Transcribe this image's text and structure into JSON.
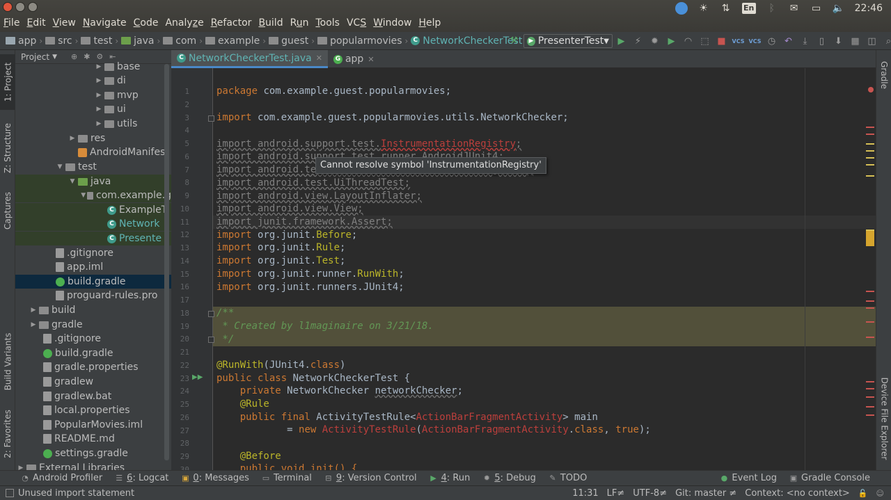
{
  "menu": [
    {
      "pre": "",
      "mn": "F",
      "post": "ile"
    },
    {
      "pre": "",
      "mn": "E",
      "post": "dit"
    },
    {
      "pre": "",
      "mn": "V",
      "post": "iew"
    },
    {
      "pre": "",
      "mn": "N",
      "post": "avigate"
    },
    {
      "pre": "",
      "mn": "C",
      "post": "ode"
    },
    {
      "pre": "Analy",
      "mn": "z",
      "post": "e"
    },
    {
      "pre": "",
      "mn": "R",
      "post": "efactor"
    },
    {
      "pre": "",
      "mn": "B",
      "post": "uild"
    },
    {
      "pre": "R",
      "mn": "u",
      "post": "n"
    },
    {
      "pre": "",
      "mn": "T",
      "post": "ools"
    },
    {
      "pre": "VC",
      "mn": "S",
      "post": ""
    },
    {
      "pre": "",
      "mn": "W",
      "post": "indow"
    },
    {
      "pre": "",
      "mn": "H",
      "post": "elp"
    }
  ],
  "tray": {
    "lang": "En",
    "time": "22:46"
  },
  "breadcrumb": [
    "app",
    "src",
    "test",
    "java",
    "com",
    "example",
    "guest",
    "popularmovies",
    "NetworkCheckerTest"
  ],
  "run_config": "PresenterTest",
  "left_tabs": {
    "project": "1: Project",
    "structure": "Z: Structure",
    "captures": "Captures",
    "build_variants": "Build Variants",
    "favorites": "2: Favorites"
  },
  "right_tabs": {
    "gradle": "Gradle",
    "device": "Device File Explorer"
  },
  "project_panel": {
    "title": "Project"
  },
  "tree": {
    "base": "base",
    "di": "di",
    "mvp": "mvp",
    "ui": "ui",
    "utils": "utils",
    "res": "res",
    "manifest": "AndroidManifest",
    "test": "test",
    "java": "java",
    "pkg": "com.example.g",
    "example_test": "ExampleT",
    "network_test": "Network",
    "presenter_test": "Presente",
    "gitignore_app": ".gitignore",
    "app_iml": "app.iml",
    "build_gradle_app": "build.gradle",
    "proguard": "proguard-rules.pro",
    "build": "build",
    "gradle": "gradle",
    "gitignore": ".gitignore",
    "build_gradle": "build.gradle",
    "gradle_props": "gradle.properties",
    "gradlew": "gradlew",
    "gradlew_bat": "gradlew.bat",
    "local_props": "local.properties",
    "iml": "PopularMovies.iml",
    "readme": "README.md",
    "settings": "settings.gradle",
    "ext": "External Libraries"
  },
  "tabs": [
    {
      "label": "NetworkCheckerTest.java"
    },
    {
      "label": "app"
    }
  ],
  "code": {
    "l1_kw": "package",
    "l1_rest": " com.example.guest.popularmovies;",
    "l3_kw": "import",
    "l3_rest": " com.example.guest.popularmovies.utils.NetworkChecker;",
    "l5_a": "import android.support.test.",
    "l5_err": "InstrumentationRegistry",
    "l5_end": ";",
    "l6": "import android.support.test.runner.AndroidJUnit4;",
    "l7": "import android.test.suitebuilder.annotation.LargeTest;",
    "l8": "import android.test.UiThreadTest;",
    "l9": "import android.view.LayoutInflater;",
    "l10": "import android.view.View;",
    "l11": "import junit.framework.Assert;",
    "l12_kw": "import",
    "l12_a": " org.junit.",
    "l12_b": "Before",
    "l12_c": ";",
    "l13_kw": "import",
    "l13_a": " org.junit.",
    "l13_b": "Rule",
    "l13_c": ";",
    "l14_kw": "import",
    "l14_a": " org.junit.",
    "l14_b": "Test",
    "l14_c": ";",
    "l15_kw": "import",
    "l15_a": " org.junit.runner.",
    "l15_b": "RunWith",
    "l15_c": ";",
    "l16_kw": "import",
    "l16_a": " org.junit.runners.JUnit4;",
    "l18": "/**",
    "l19": " * Created by l1maginaire on 3/21/18.",
    "l20": " */",
    "l22_ann": "@RunWith",
    "l22_a": "(JUnit4.",
    "l22_kw": "class",
    "l22_b": ")",
    "l23_kw": "public class",
    "l23_a": " NetworkCheckerTest {",
    "l24_kw": "    private",
    "l24_a": " NetworkChecker ",
    "l24_u": "networkChecker",
    "l24_b": ";",
    "l25_ann": "    @Rule",
    "l26_kw": "    public final",
    "l26_a": " ActivityTestRule<",
    "l26_r": "ActionBarFragmentActivity",
    "l26_b": "> main",
    "l27_a": "            = ",
    "l27_kw": "new",
    "l27_r1": " ActivityTestRule",
    "l27_b": "(",
    "l27_r2": "ActionBarFragmentActivity",
    "l27_c": ".",
    "l27_kw2": "class",
    "l27_d": ", ",
    "l27_kw3": "true",
    "l27_e": ");",
    "l29_ann": "    @Before",
    "l30": "    public void init() {"
  },
  "tooltip": "Cannot resolve symbol 'InstrumentationRegistry'",
  "bottom_tabs": {
    "profiler": "Android Profiler",
    "logcat_n": "6",
    "logcat": ": Logcat",
    "messages_n": "0",
    "messages": ": Messages",
    "terminal": "Terminal",
    "vc_n": "9",
    "vc": ": Version Control",
    "run_n": "4",
    "run": ": Run",
    "debug_n": "5",
    "debug": ": Debug",
    "todo": "TODO",
    "event_log": "Event Log",
    "gradle_console": "Gradle Console"
  },
  "status": {
    "message": "Unused import statement",
    "position": "11:31",
    "lf": "LF≠",
    "encoding": "UTF-8≠",
    "git": "Git: master ≠",
    "context": "Context: <no context>"
  },
  "colors": {
    "accent": "#4a88c7",
    "run": "#59a869",
    "error": "#bc3f3c",
    "selection": "#0d293e"
  }
}
